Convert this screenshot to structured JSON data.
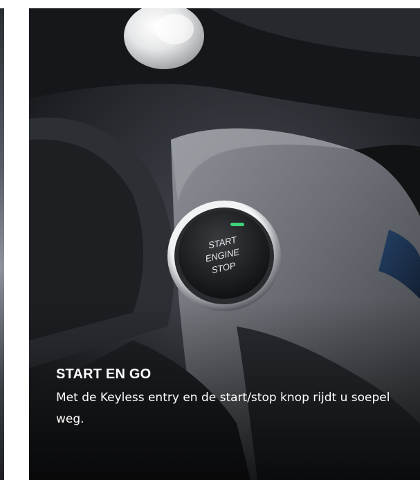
{
  "slide": {
    "title": "START EN GO",
    "description": "Met de Keyless entry en de start/stop knop rijdt u soepel weg."
  },
  "button_label": {
    "line1": "START",
    "line2": "ENGINE",
    "line3": "STOP"
  },
  "indicator_color": "#3fd27a"
}
